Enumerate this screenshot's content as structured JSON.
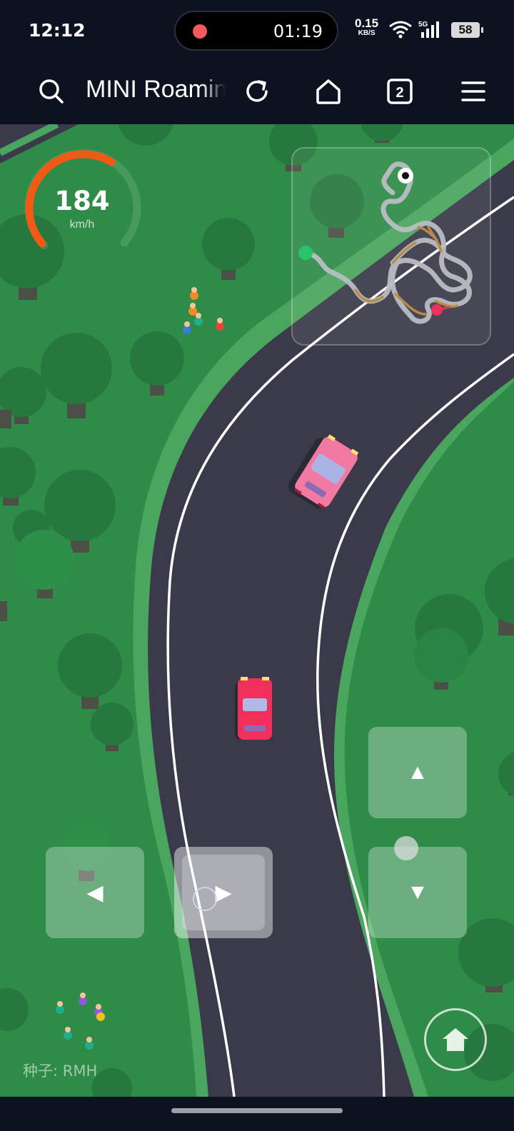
{
  "status": {
    "time": "12:12",
    "recording_time": "01:19",
    "net_speed": "0.15",
    "net_unit": "KB/S",
    "network": "5G",
    "battery": "58"
  },
  "browser": {
    "title": "MINI Roaming",
    "tab_count": "2",
    "icons": [
      "search-icon",
      "reload-icon",
      "home-icon",
      "tabs-icon",
      "menu-icon"
    ]
  },
  "hud": {
    "speed": "184",
    "speed_unit": "km/h",
    "speed_gauge_fraction": 0.62,
    "seed_label": "种子: RMH"
  },
  "controls": {
    "up": "▲",
    "down": "▼",
    "left": "◀",
    "right": "▶"
  },
  "colors": {
    "grass": "#2e8b48",
    "road": "#3a3a4a",
    "gauge": "#f05a14",
    "player_car": "#f0305a",
    "rival_car": "#f27aa2"
  }
}
